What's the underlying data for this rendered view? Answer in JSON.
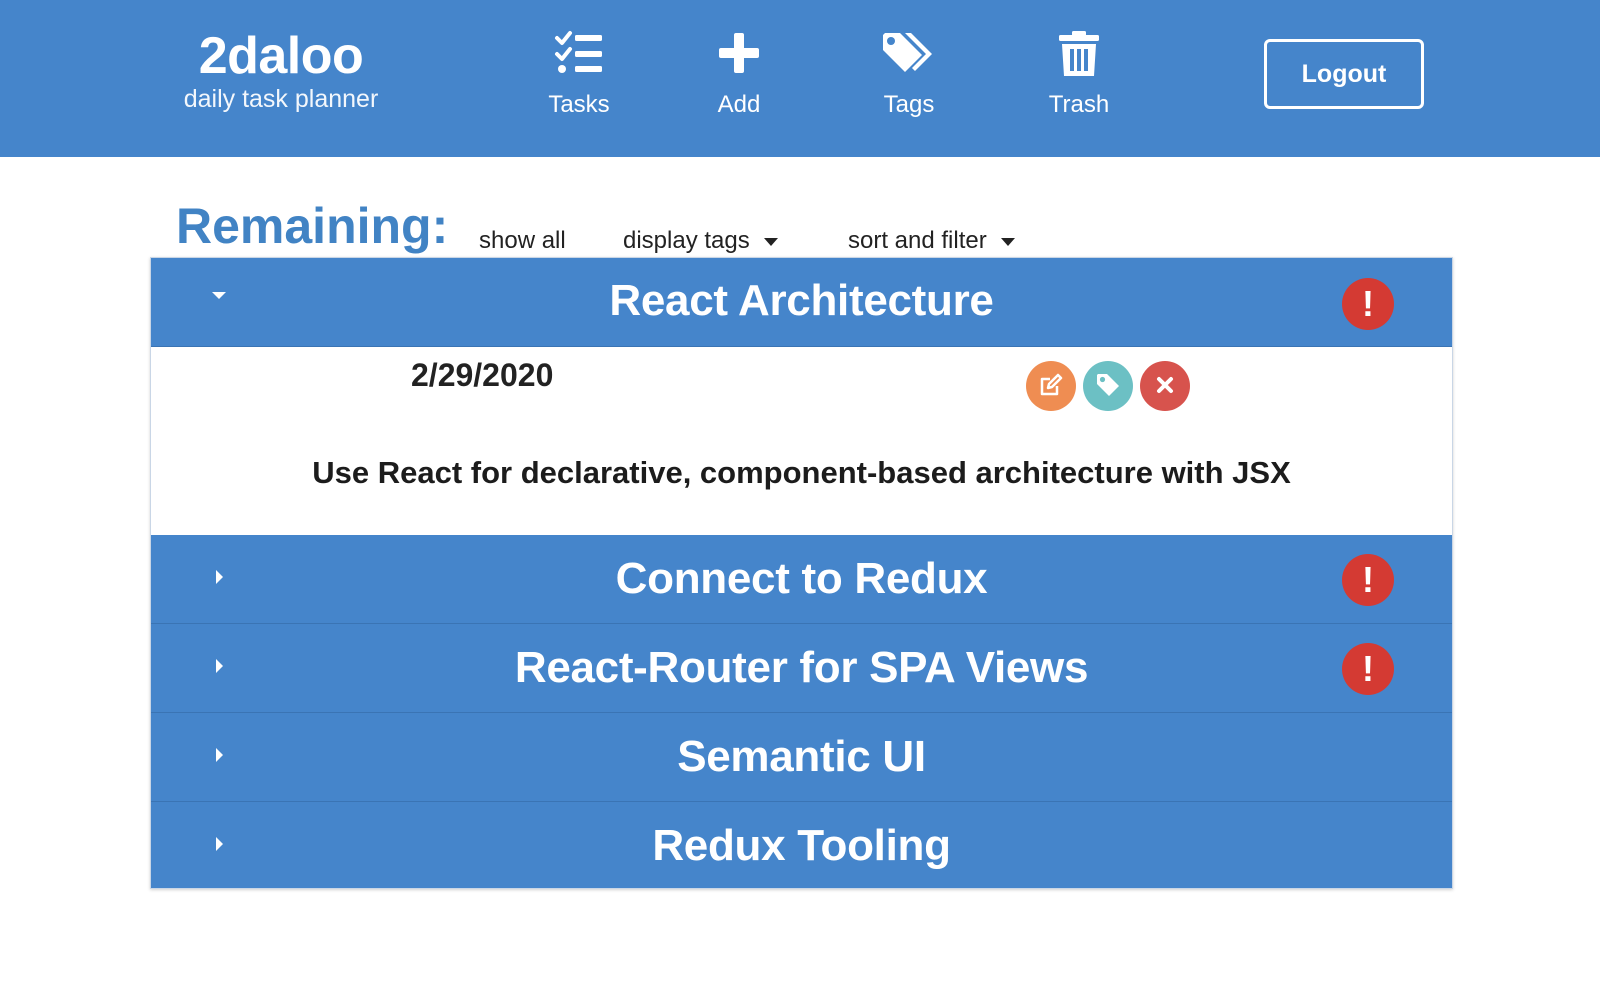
{
  "header": {
    "brand": {
      "name": "2daloo",
      "tagline": "daily task planner"
    },
    "nav": [
      {
        "label": "Tasks",
        "icon": "tasks-icon"
      },
      {
        "label": "Add",
        "icon": "plus-icon"
      },
      {
        "label": "Tags",
        "icon": "tags-icon"
      },
      {
        "label": "Trash",
        "icon": "trash-icon"
      }
    ],
    "logout_label": "Logout"
  },
  "toolbar": {
    "title": "Remaining:",
    "show_all": "show all",
    "display_tags": "display tags",
    "sort_filter": "sort and filter"
  },
  "tasks": [
    {
      "title": "React Architecture",
      "expanded": true,
      "alert": true,
      "date": "2/29/2020",
      "description": "Use React for declarative, component-based architecture with JSX"
    },
    {
      "title": "Connect to Redux",
      "expanded": false,
      "alert": true
    },
    {
      "title": "React-Router for SPA Views",
      "expanded": false,
      "alert": true
    },
    {
      "title": "Semantic UI",
      "expanded": false,
      "alert": false
    },
    {
      "title": "Redux Tooling",
      "expanded": false,
      "alert": false
    }
  ],
  "alert_symbol": "!",
  "colors": {
    "header_bg": "#4585cb",
    "title_blue": "#4183c4",
    "alert_red": "#d43a33",
    "edit_orange": "#ef8d52",
    "tag_teal": "#6cc0c4",
    "delete_red": "#d7534d"
  }
}
